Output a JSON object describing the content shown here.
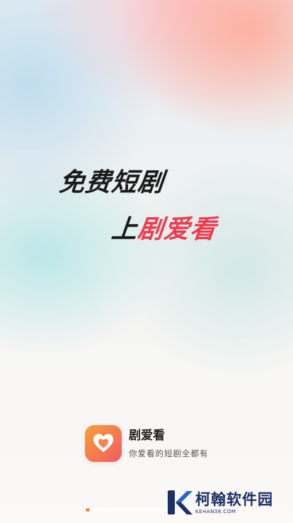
{
  "slogan": {
    "line1": "免费短剧",
    "line2_prefix": "上",
    "line2_accent": "剧爱看"
  },
  "colors": {
    "accent": "#ee3b4f",
    "text_dark": "#1a1a1a",
    "icon_gradient": [
      "#f7a13a",
      "#ef5a66"
    ],
    "progress_fill": "#f58a3a",
    "watermark": "#1c2f66"
  },
  "brand": {
    "icon": "heart-icon",
    "name": "剧爱看",
    "tagline": "你爱看的短剧全都有"
  },
  "loading": {
    "progress": 0.02
  },
  "watermark": {
    "icon": "kehan-k-logo-icon",
    "title": "柯翰软件园",
    "url": "KEHAN38.COM"
  }
}
